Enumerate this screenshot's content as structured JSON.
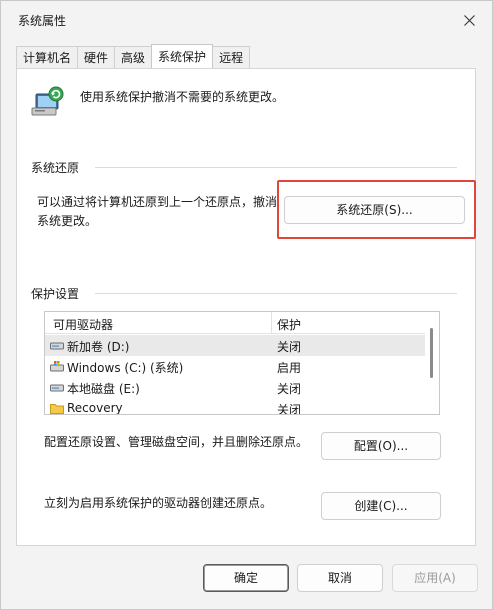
{
  "window": {
    "title": "系统属性"
  },
  "tabs": [
    {
      "label": "计算机名"
    },
    {
      "label": "硬件"
    },
    {
      "label": "高级"
    },
    {
      "label": "系统保护"
    },
    {
      "label": "远程"
    }
  ],
  "intro": "使用系统保护撤消不需要的系统更改。",
  "restore_section": {
    "label": "系统还原",
    "description_line1": "可以通过将计算机还原到上一个还原点，撤消",
    "description_line2": "系统更改。",
    "button_label": "系统还原(S)..."
  },
  "protection_section": {
    "label": "保护设置",
    "columns": {
      "drive": "可用驱动器",
      "protection": "保护"
    },
    "drives": [
      {
        "name": "新加卷 (D:)",
        "protection": "关闭",
        "icon": "drive-icon"
      },
      {
        "name": "Windows (C:) (系统)",
        "protection": "启用",
        "icon": "system-drive-icon"
      },
      {
        "name": "本地磁盘 (E:)",
        "protection": "关闭",
        "icon": "drive-icon"
      },
      {
        "name": "Recovery",
        "protection": "关闭",
        "icon": "folder-icon"
      }
    ],
    "configure_text": "配置还原设置、管理磁盘空间，并且删除还原点。",
    "configure_button": "配置(O)...",
    "create_text": "立刻为启用系统保护的驱动器创建还原点。",
    "create_button": "创建(C)..."
  },
  "buttons": {
    "ok": "确定",
    "cancel": "取消",
    "apply": "应用(A)"
  },
  "colors": {
    "highlight": "#e0473b",
    "accent": "#1e6fc4"
  }
}
